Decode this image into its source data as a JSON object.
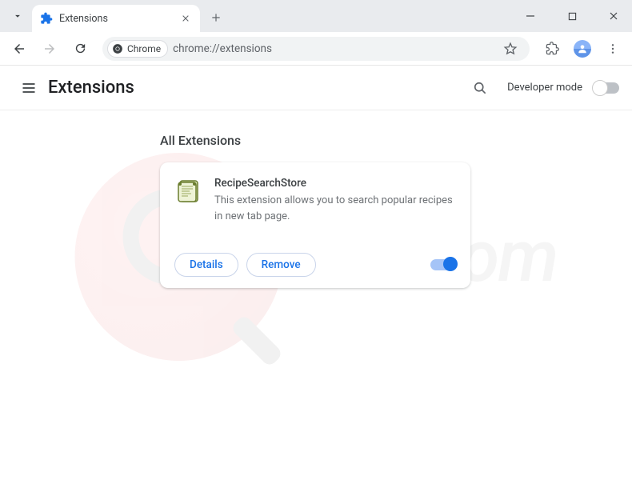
{
  "tab": {
    "title": "Extensions"
  },
  "addressbar": {
    "chip_label": "Chrome",
    "url": "chrome://extensions"
  },
  "ext_header": {
    "title": "Extensions",
    "dev_mode_label": "Developer mode"
  },
  "main": {
    "section_title": "All Extensions",
    "extension": {
      "name": "RecipeSearchStore",
      "description": "This extension allows you to search popular recipes in new tab page.",
      "details_label": "Details",
      "remove_label": "Remove"
    }
  },
  "watermark": {
    "text": "risk.com"
  }
}
